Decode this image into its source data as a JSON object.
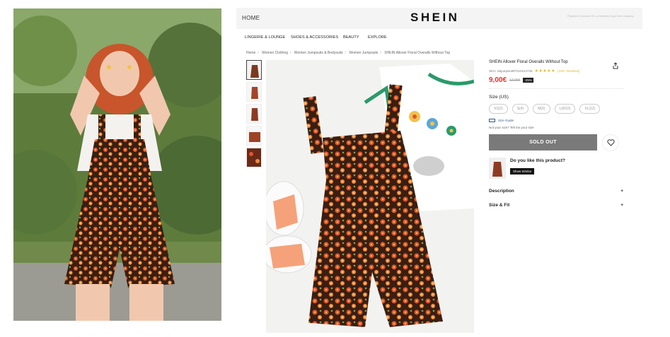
{
  "topbar": {
    "home_label": "HOME",
    "logo": "SHEIN",
    "promo_text": "Register & receive €5 on freebies & get free shipping"
  },
  "nav": {
    "items": [
      "LINGERIE & LOUNGE",
      "SHOES & ACCESSORIES",
      "BEAUTY",
      "EXPLORE"
    ]
  },
  "breadcrumb": [
    "Home",
    "Women Clothing",
    "Women Jumpsuits & Bodysuits",
    "Women Jumpsuits",
    "SHEIN Allover Floral Overalls Without Top"
  ],
  "product": {
    "title": "SHEIN Allover Floral Overalls Without Top",
    "sku": "SKU: swjumpsuit07210414745",
    "stars": "★★★★★",
    "reviews": "(100+ Reviews)",
    "price": "9,00€",
    "old_price": "12,00€",
    "discount": "-25%",
    "size_label": "Size (US)",
    "sizes": [
      "XS(2)",
      "S(4)",
      "M(6)",
      "L(8/10)",
      "XL(12)"
    ],
    "size_guide": "Size Guide",
    "fit_prompt": "Not your size? Tell me your size",
    "sold_out": "SOLD OUT",
    "similar_question": "Do you like this product?",
    "show_similar": "Show Similar",
    "accordion": [
      "Description",
      "Size & Fit"
    ],
    "accordion_icon": "+"
  },
  "colors": {
    "price": "#e8312f",
    "star": "#e0b626",
    "sold_out_bg": "#7a7a7a",
    "romper_base": "#3a1e12",
    "flower": "#e0562e"
  },
  "icons": [
    "share-icon",
    "heart-icon",
    "ruler-icon",
    "star-icon",
    "plus-icon"
  ]
}
